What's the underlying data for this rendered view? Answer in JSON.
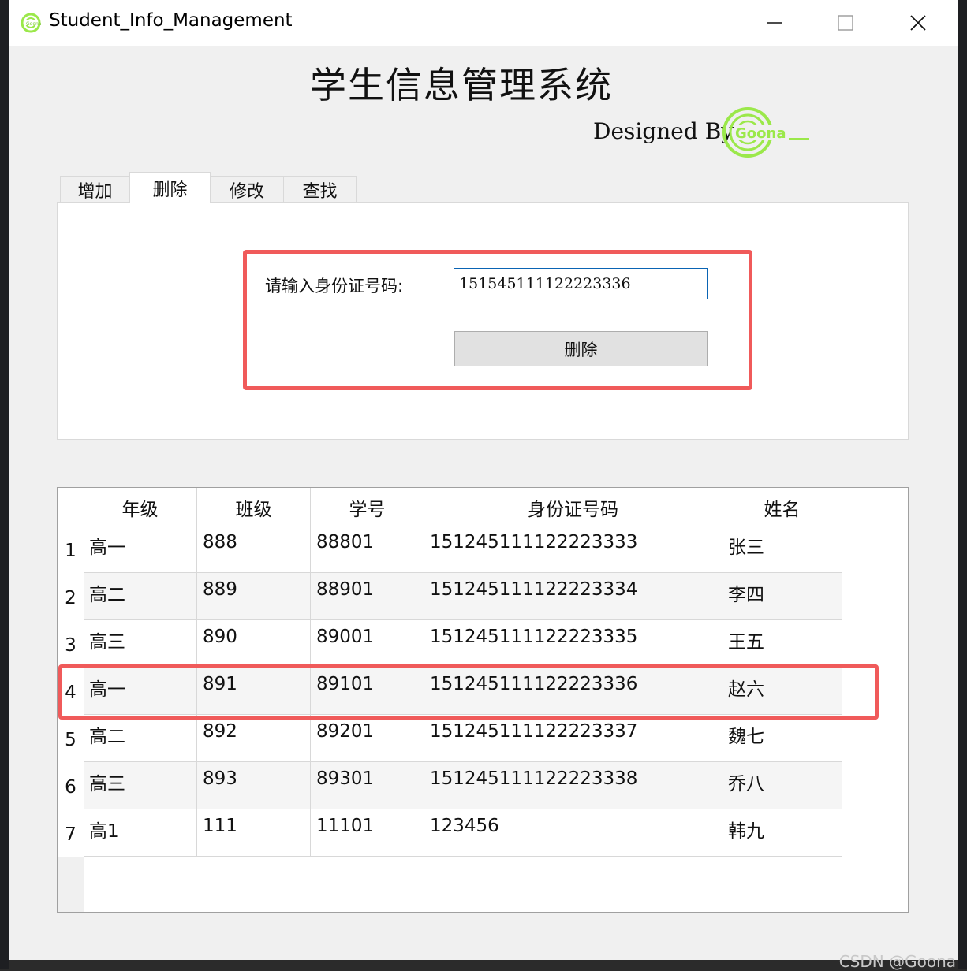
{
  "window": {
    "title": "Student_Info_Management",
    "minimize": "—",
    "maximize": "☐",
    "close": "✕"
  },
  "header": {
    "app_title": "学生信息管理系统",
    "designed_by": "Designed By",
    "logo_text": "Goona"
  },
  "tabs": [
    {
      "label": "增加"
    },
    {
      "label": "删除"
    },
    {
      "label": "修改"
    },
    {
      "label": "查找"
    }
  ],
  "active_tab": "删除",
  "delete_form": {
    "id_label": "请输入身份证号码:",
    "id_value": "151545111122223336",
    "delete_button": "删除"
  },
  "table": {
    "columns": [
      "年级",
      "班级",
      "学号",
      "身份证号码",
      "姓名"
    ],
    "rows": [
      {
        "num": "1",
        "cells": [
          "高一",
          "888",
          "88801",
          "151245111122223333",
          "张三"
        ]
      },
      {
        "num": "2",
        "cells": [
          "高二",
          "889",
          "88901",
          "151245111122223334",
          "李四"
        ]
      },
      {
        "num": "3",
        "cells": [
          "高三",
          "890",
          "89001",
          "151245111122223335",
          "王五"
        ]
      },
      {
        "num": "4",
        "cells": [
          "高一",
          "891",
          "89101",
          "151245111122223336",
          "赵六"
        ]
      },
      {
        "num": "5",
        "cells": [
          "高二",
          "892",
          "89201",
          "151245111122223337",
          "魏七"
        ]
      },
      {
        "num": "6",
        "cells": [
          "高三",
          "893",
          "89301",
          "151245111122223338",
          "乔八"
        ]
      },
      {
        "num": "7",
        "cells": [
          "高1",
          "111",
          "11101",
          "123456",
          "韩九"
        ]
      }
    ]
  },
  "colors": {
    "highlight": "#f05a5a",
    "logo_green": "#9be84a",
    "input_border": "#0a64b4"
  },
  "watermark": "CSDN @Goona"
}
